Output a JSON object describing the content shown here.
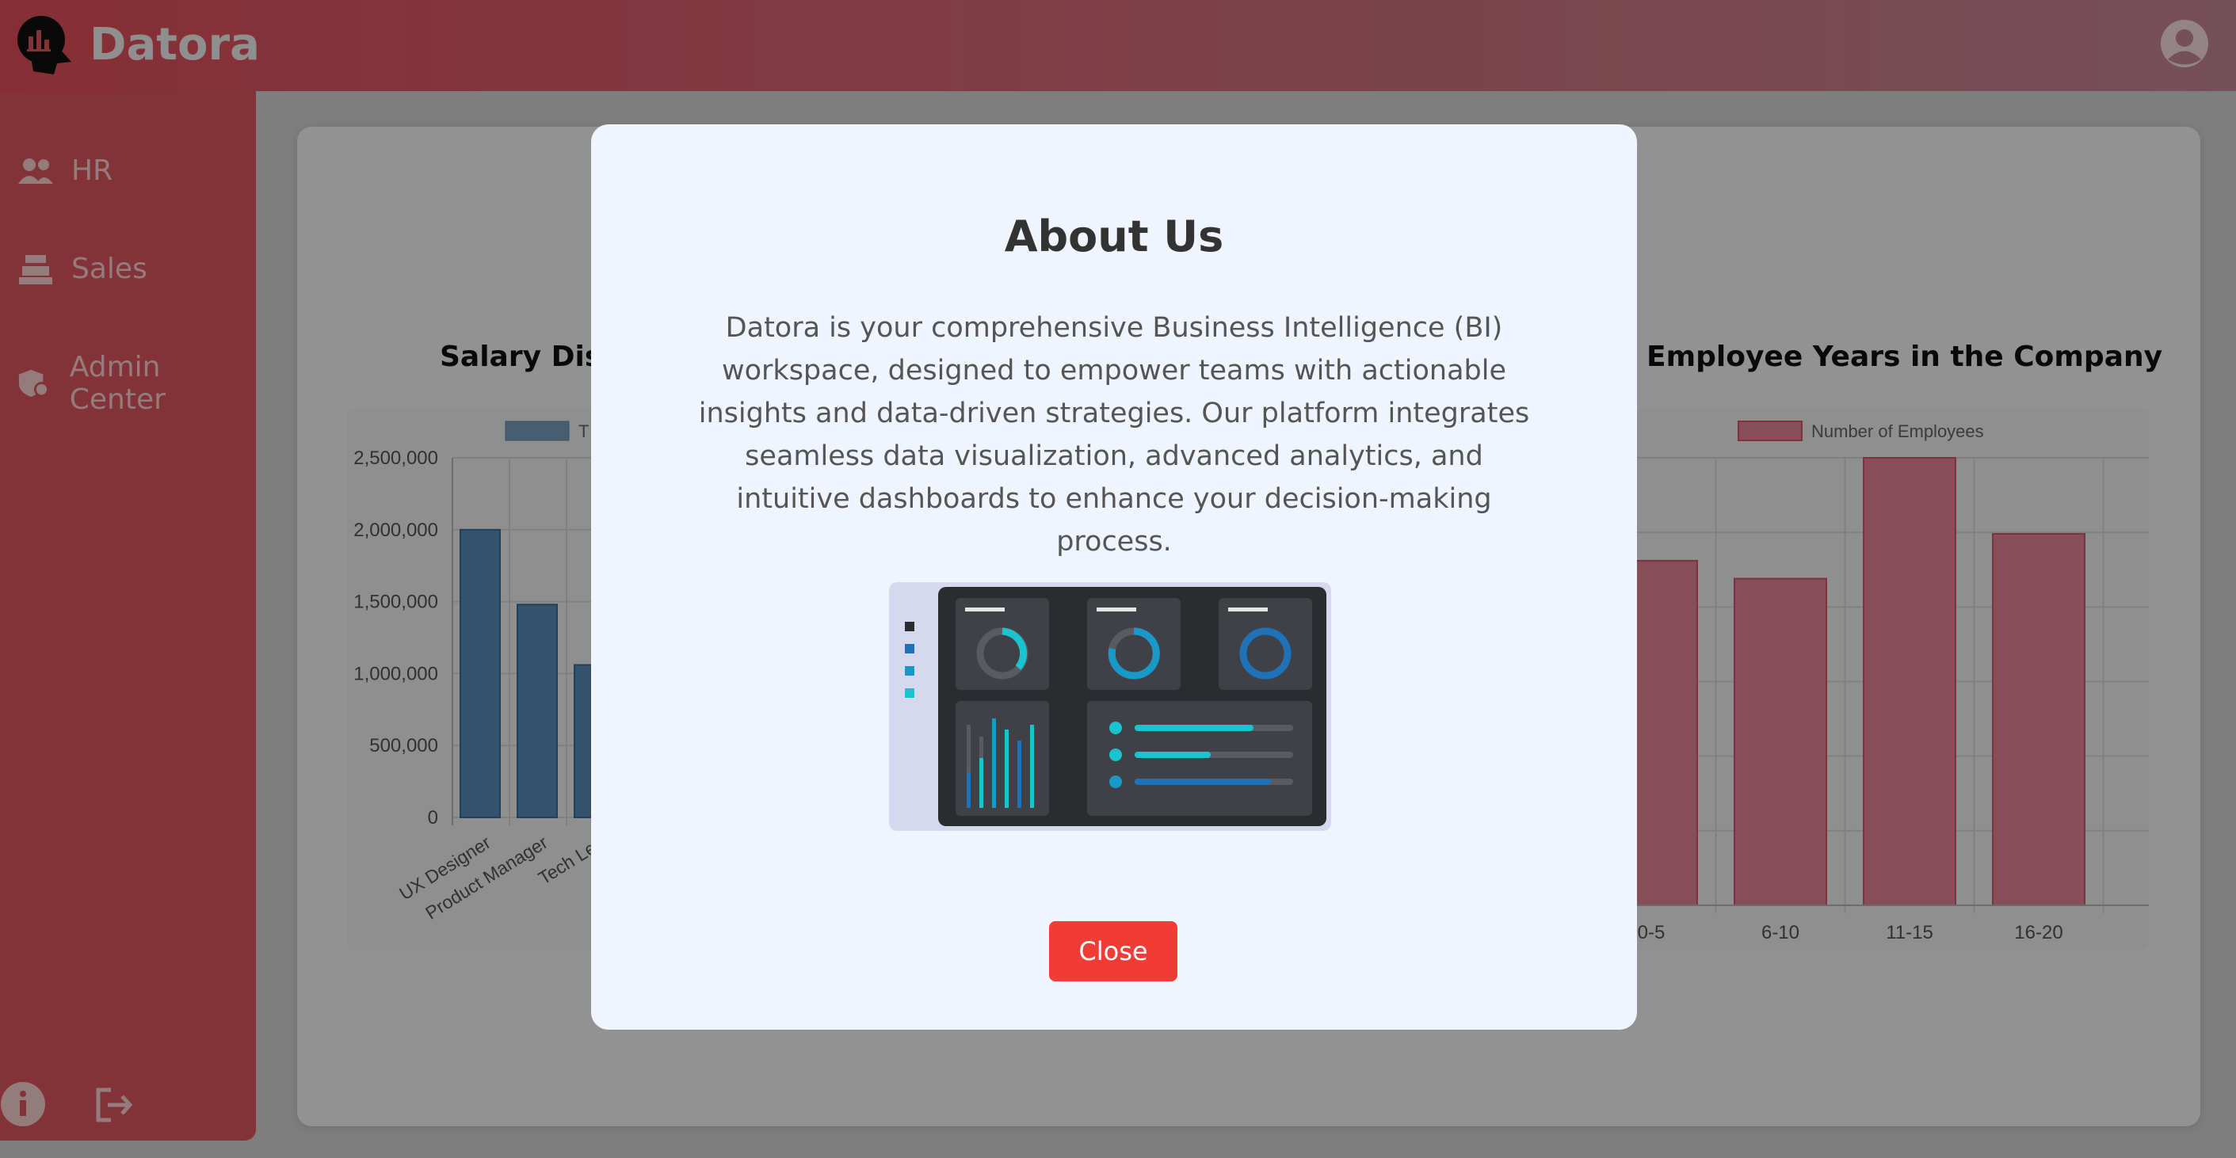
{
  "header": {
    "brand": "Datora",
    "logo_icon": "chart-head-icon",
    "user_icon": "user-circle-icon"
  },
  "sidebar": {
    "items": [
      {
        "label": "HR",
        "icon": "people-icon"
      },
      {
        "label": "Sales",
        "icon": "cash-register-icon"
      },
      {
        "label": "Admin Center",
        "icon": "shield-user-icon"
      }
    ],
    "bottom": {
      "info_icon": "info-icon",
      "logout_icon": "logout-icon"
    }
  },
  "charts": [
    {
      "title": "Salary Dist",
      "legend": "T",
      "colors": {
        "bar": "#5b8db8"
      },
      "chart_data": {
        "type": "bar",
        "categories": [
          "UX Designer",
          "Product Manager",
          "Tech Lea"
        ],
        "values": [
          2000000,
          1480000,
          1060000
        ],
        "ylim": [
          0,
          2500000
        ],
        "yticks": [
          "2,500,000",
          "2,000,000",
          "1,500,000",
          "1,000,000",
          "500,000",
          "0"
        ]
      }
    },
    {
      "title": "Employee Years in the Company",
      "legend": "Number of Employees",
      "colors": {
        "bar": "#e8879a"
      },
      "chart_data": {
        "type": "bar",
        "categories": [
          "0-5",
          "6-10",
          "11-15",
          "16-20"
        ],
        "values": [
          0.77,
          0.73,
          1.0,
          0.83
        ],
        "ylim": [
          0,
          1.0
        ]
      }
    }
  ],
  "modal": {
    "title": "About Us",
    "text": "Datora is your comprehensive Business Intelligence (BI) workspace, designed to empower teams with actionable insights and data-driven strategies. Our platform integrates seamless data visualization, advanced analytics, and intuitive dashboards to enhance your decision-making process.",
    "close_label": "Close",
    "illustration_icon": "dashboard-illustration-icon"
  }
}
